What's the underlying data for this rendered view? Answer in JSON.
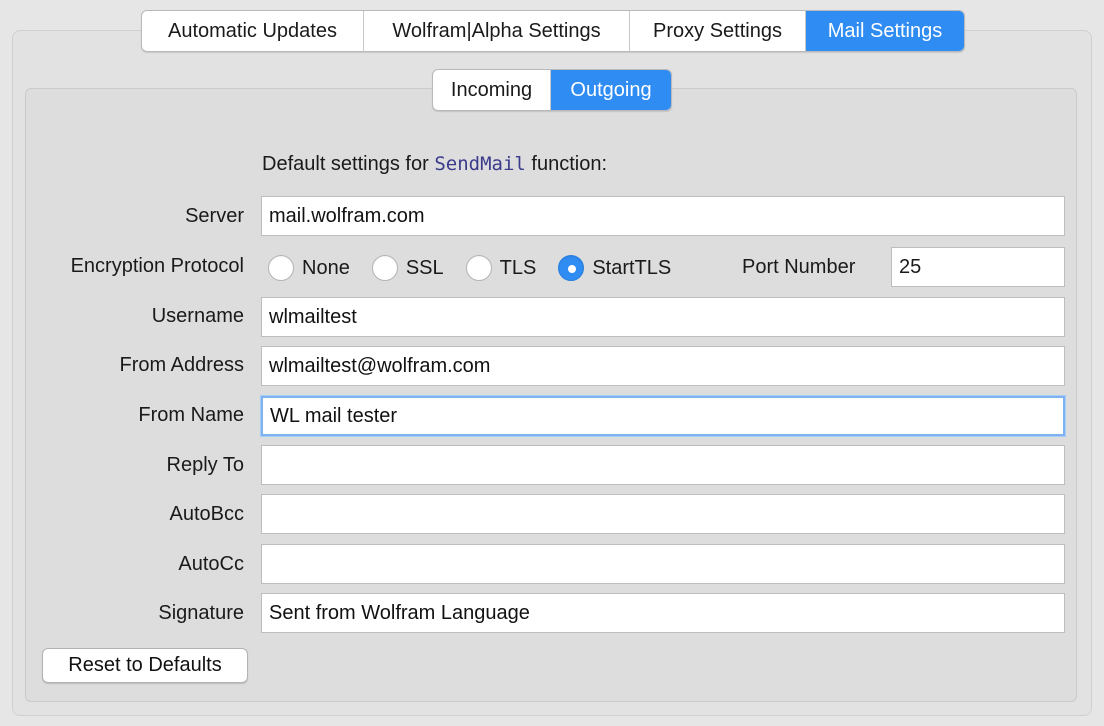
{
  "main_tabs": [
    {
      "label": "Automatic Updates",
      "active": false
    },
    {
      "label": "Wolfram|Alpha Settings",
      "active": false
    },
    {
      "label": "Proxy Settings",
      "active": false
    },
    {
      "label": "Mail Settings",
      "active": true
    }
  ],
  "sub_tabs": [
    {
      "label": "Incoming",
      "active": false
    },
    {
      "label": "Outgoing",
      "active": true
    }
  ],
  "intro": {
    "prefix": "Default settings for",
    "function_name": "SendMail",
    "suffix": "function:"
  },
  "server": {
    "label": "Server",
    "value": "mail.wolfram.com"
  },
  "encryption": {
    "label": "Encryption Protocol",
    "options": [
      "None",
      "SSL",
      "TLS",
      "StartTLS"
    ],
    "selected": "StartTLS"
  },
  "port": {
    "label": "Port Number",
    "value": "25"
  },
  "username": {
    "label": "Username",
    "value": "wlmailtest"
  },
  "from_address": {
    "label": "From Address",
    "value": "wlmailtest@wolfram.com"
  },
  "from_name": {
    "label": "From Name",
    "value": "WL mail tester"
  },
  "reply_to": {
    "label": "Reply To",
    "value": ""
  },
  "auto_bcc": {
    "label": "AutoBcc",
    "value": ""
  },
  "auto_cc": {
    "label": "AutoCc",
    "value": ""
  },
  "signature": {
    "label": "Signature",
    "value": "Sent from Wolfram Language"
  },
  "reset_button": {
    "label": "Reset to Defaults"
  },
  "colors": {
    "accent": "#2f8cf3",
    "focus_ring": "#7fb2f0",
    "code_text": "#3b3b8c"
  }
}
